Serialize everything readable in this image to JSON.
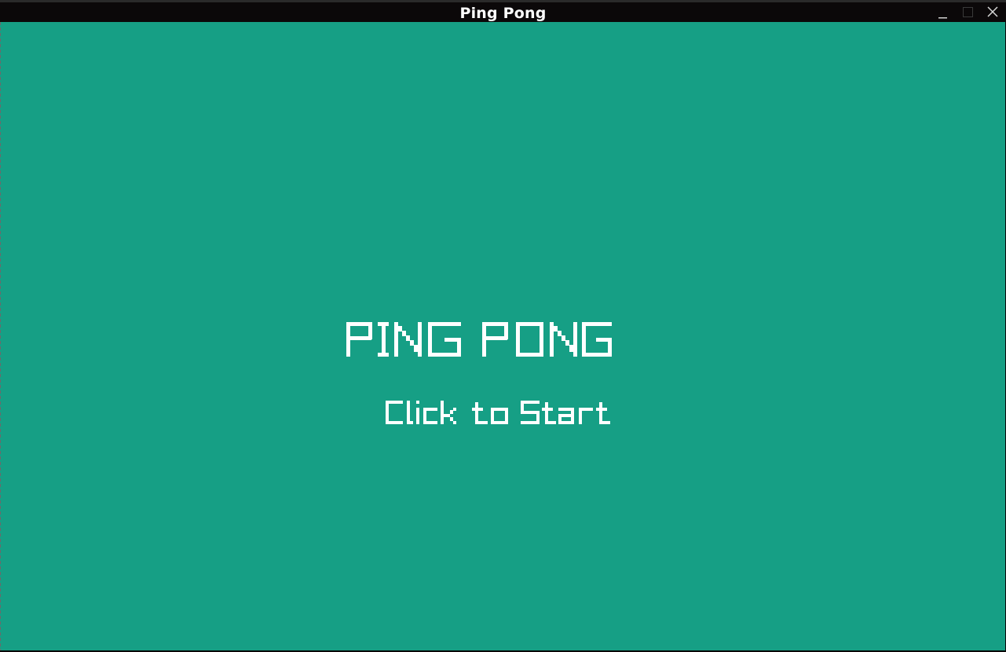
{
  "window": {
    "title": "Ping Pong",
    "controls": {
      "minimize_icon": "minimize-icon",
      "maximize_icon": "maximize-icon",
      "close_icon": "close-icon"
    }
  },
  "game": {
    "title": "PING PONG",
    "prompt": "Click to Start",
    "background_color": "#169f85",
    "text_color": "#ffffff"
  }
}
